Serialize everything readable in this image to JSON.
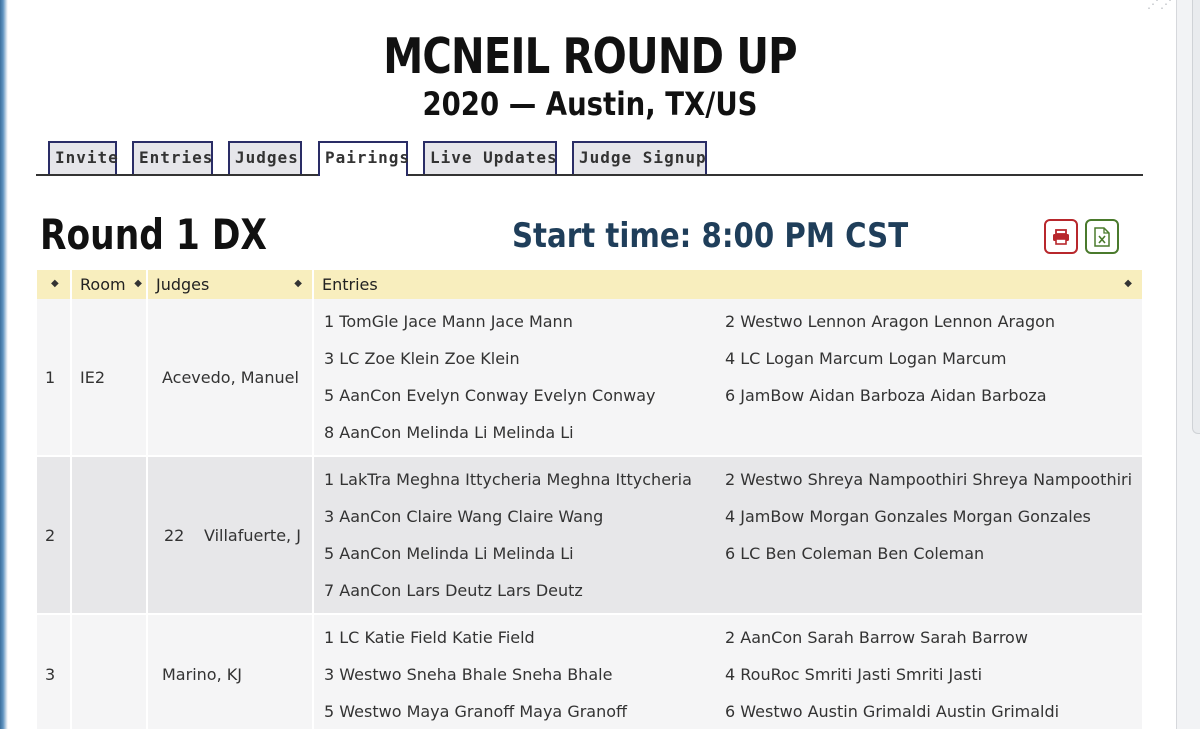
{
  "tournament": {
    "name": "MCNEIL ROUND UP",
    "subtitle": "2020 — Austin, TX/US"
  },
  "tabs": [
    {
      "label": "Invite",
      "active": false
    },
    {
      "label": "Entries",
      "active": false
    },
    {
      "label": "Judges",
      "active": false
    },
    {
      "label": "Pairings",
      "active": true
    },
    {
      "label": "Live Updates",
      "active": false
    },
    {
      "label": "Judge Signup",
      "active": false
    }
  ],
  "round": {
    "title": "Round 1 DX",
    "start_time": "Start time: 8:00 PM CST"
  },
  "actions": {
    "print_icon": "printer-icon",
    "excel_icon": "excel-file-icon",
    "print_color": "#b8272c",
    "excel_color": "#4a7a2c"
  },
  "table": {
    "headers": {
      "index": "",
      "room": "Room",
      "judges": "Judges",
      "entries": "Entries"
    },
    "header_bg": "#f8eebe",
    "rows": [
      {
        "index": "1",
        "room": "IE2",
        "judge_code": "",
        "judge": "Acevedo, Manuel",
        "entries": [
          "1 TomGle Jace Mann Jace Mann",
          "2 Westwo Lennon Aragon Lennon Aragon",
          "3 LC Zoe Klein Zoe Klein",
          "4 LC Logan Marcum Logan Marcum",
          "5 AanCon Evelyn Conway Evelyn Conway",
          "6 JamBow Aidan Barboza Aidan Barboza",
          "8 AanCon Melinda Li Melinda Li"
        ]
      },
      {
        "index": "2",
        "room": "",
        "judge_code": "22",
        "judge": "Villafuerte, J",
        "entries": [
          "1 LakTra Meghna Ittycheria Meghna Ittycheria",
          "2 Westwo Shreya Nampoothiri Shreya Nampoothiri",
          "3 AanCon Claire Wang Claire Wang",
          "4 JamBow Morgan Gonzales Morgan Gonzales",
          "5 AanCon Melinda Li Melinda Li",
          "6 LC Ben Coleman Ben Coleman",
          "7 AanCon Lars Deutz Lars Deutz"
        ]
      },
      {
        "index": "3",
        "room": "",
        "judge_code": "",
        "judge": "Marino, KJ",
        "entries": [
          "1 LC Katie Field Katie Field",
          "2 AanCon Sarah Barrow Sarah Barrow",
          "3 Westwo Sneha Bhale Sneha Bhale",
          "4 RouRoc Smriti Jasti Smriti Jasti",
          "5 Westwo Maya Granoff Maya Granoff",
          "6 Westwo Austin Grimaldi Austin Grimaldi"
        ]
      }
    ]
  }
}
